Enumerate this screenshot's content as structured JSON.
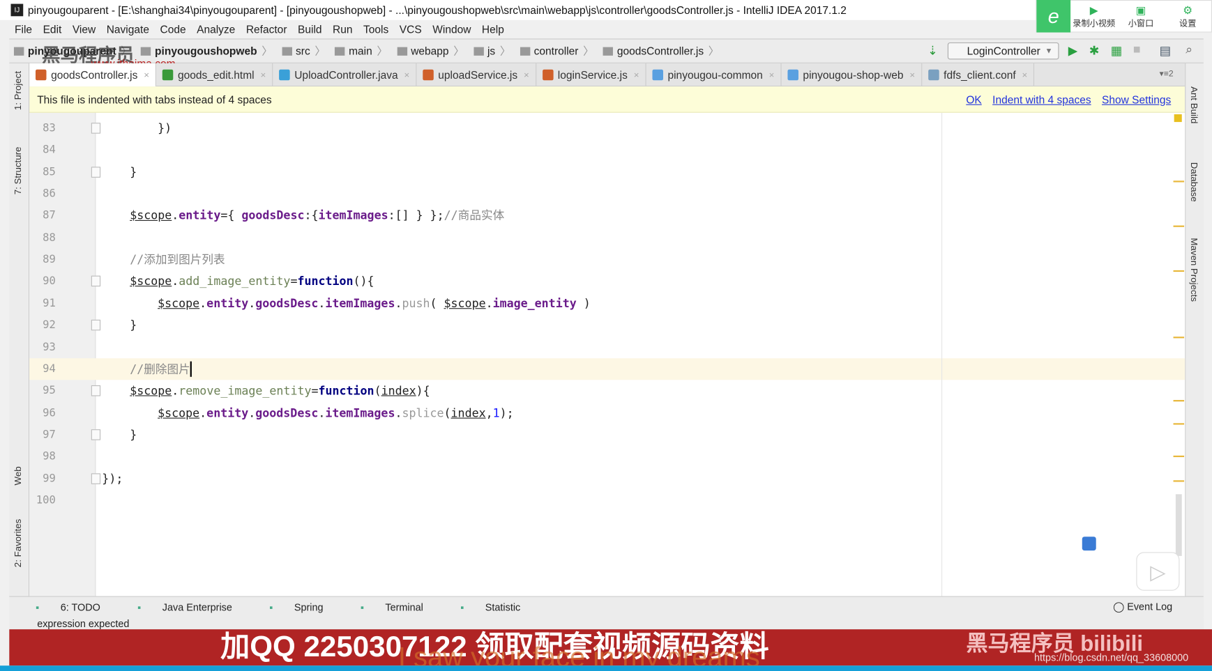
{
  "window": {
    "title": "pinyougouparent - [E:\\shanghai34\\pinyougouparent] - [pinyougoushopweb] - ...\\pinyougoushopweb\\src\\main\\webapp\\js\\controller\\goodsController.js - IntelliJ IDEA 2017.1.2"
  },
  "recorder": {
    "logo": "e",
    "buttons": [
      {
        "icon": "video-icon",
        "label": "录制小视频"
      },
      {
        "icon": "tv-icon",
        "label": "小窗口"
      },
      {
        "icon": "gear-icon",
        "label": "设置"
      }
    ]
  },
  "menu": [
    "File",
    "Edit",
    "View",
    "Navigate",
    "Code",
    "Analyze",
    "Refactor",
    "Build",
    "Run",
    "Tools",
    "VCS",
    "Window",
    "Help"
  ],
  "breadcrumb": [
    "pinyougouparent",
    "pinyougoushopweb",
    "src",
    "main",
    "webapp",
    "js",
    "controller",
    "goodsController.js"
  ],
  "watermark": {
    "brand": "黑马程序员",
    "url": "www.itheima.com"
  },
  "toolbar": {
    "run_config": "LoginController"
  },
  "tabs": [
    {
      "label": "goodsController.js",
      "icon": "js",
      "active": true
    },
    {
      "label": "goods_edit.html",
      "icon": "html"
    },
    {
      "label": "UploadController.java",
      "icon": "java-class"
    },
    {
      "label": "uploadService.js",
      "icon": "js"
    },
    {
      "label": "loginService.js",
      "icon": "js"
    },
    {
      "label": "pinyougou-common",
      "icon": "maven"
    },
    {
      "label": "pinyougou-shop-web",
      "icon": "maven"
    },
    {
      "label": "fdfs_client.conf",
      "icon": "config"
    }
  ],
  "tabs_overflow": "2",
  "notice": {
    "text": "This file is indented with tabs instead of 4 spaces",
    "ok": "OK",
    "indent": "Indent with 4 spaces",
    "settings": "Show Settings"
  },
  "left_tools": [
    "1: Project",
    "7: Structure",
    "Web",
    "2: Favorites"
  ],
  "right_tools": [
    "Ant Build",
    "Database",
    "Maven Projects"
  ],
  "editor": {
    "current_line": 94,
    "lines": [
      {
        "n": 83,
        "indent": 2,
        "tokens": [
          [
            "plain",
            "})"
          ]
        ]
      },
      {
        "n": 84,
        "indent": 0,
        "tokens": []
      },
      {
        "n": 85,
        "indent": 1,
        "tokens": [
          [
            "plain",
            "}"
          ]
        ]
      },
      {
        "n": 86,
        "indent": 0,
        "tokens": []
      },
      {
        "n": 87,
        "indent": 1,
        "tokens": [
          [
            "var",
            "$scope"
          ],
          [
            "plain",
            "."
          ],
          [
            "prop",
            "entity"
          ],
          [
            "plain",
            "={ "
          ],
          [
            "prop",
            "goodsDesc"
          ],
          [
            "plain",
            ":{"
          ],
          [
            "prop",
            "itemImages"
          ],
          [
            "plain",
            ":[] } };"
          ],
          [
            "com",
            "//商品实体"
          ]
        ]
      },
      {
        "n": 88,
        "indent": 0,
        "tokens": []
      },
      {
        "n": 89,
        "indent": 1,
        "tokens": [
          [
            "com",
            "//添加到图片列表"
          ]
        ]
      },
      {
        "n": 90,
        "indent": 1,
        "tokens": [
          [
            "var",
            "$scope"
          ],
          [
            "plain",
            "."
          ],
          [
            "fn",
            "add_image_entity"
          ],
          [
            "plain",
            "="
          ],
          [
            "kw",
            "function"
          ],
          [
            "plain",
            "(){"
          ]
        ]
      },
      {
        "n": 91,
        "indent": 2,
        "tokens": [
          [
            "var",
            "$scope"
          ],
          [
            "plain",
            "."
          ],
          [
            "prop",
            "entity"
          ],
          [
            "plain",
            "."
          ],
          [
            "prop",
            "goodsDesc"
          ],
          [
            "plain",
            "."
          ],
          [
            "prop",
            "itemImages"
          ],
          [
            "plain",
            "."
          ],
          [
            "meth",
            "push"
          ],
          [
            "plain",
            "( "
          ],
          [
            "var",
            "$scope"
          ],
          [
            "plain",
            "."
          ],
          [
            "prop",
            "image_entity"
          ],
          [
            "plain",
            " )"
          ]
        ]
      },
      {
        "n": 92,
        "indent": 1,
        "tokens": [
          [
            "plain",
            "}"
          ]
        ]
      },
      {
        "n": 93,
        "indent": 0,
        "tokens": []
      },
      {
        "n": 94,
        "indent": 1,
        "tokens": [
          [
            "com",
            "//删除图片"
          ]
        ]
      },
      {
        "n": 95,
        "indent": 1,
        "tokens": [
          [
            "var",
            "$scope"
          ],
          [
            "plain",
            "."
          ],
          [
            "fn",
            "remove_image_entity"
          ],
          [
            "plain",
            "="
          ],
          [
            "kw",
            "function"
          ],
          [
            "plain",
            "("
          ],
          [
            "param",
            "index"
          ],
          [
            "plain",
            "){"
          ]
        ]
      },
      {
        "n": 96,
        "indent": 2,
        "tokens": [
          [
            "var",
            "$scope"
          ],
          [
            "plain",
            "."
          ],
          [
            "prop",
            "entity"
          ],
          [
            "plain",
            "."
          ],
          [
            "prop",
            "goodsDesc"
          ],
          [
            "plain",
            "."
          ],
          [
            "prop",
            "itemImages"
          ],
          [
            "plain",
            "."
          ],
          [
            "meth",
            "splice"
          ],
          [
            "plain",
            "("
          ],
          [
            "param",
            "index"
          ],
          [
            "plain",
            ","
          ],
          [
            "num",
            "1"
          ],
          [
            "plain",
            ");"
          ]
        ]
      },
      {
        "n": 97,
        "indent": 1,
        "tokens": [
          [
            "plain",
            "}"
          ]
        ]
      },
      {
        "n": 98,
        "indent": 0,
        "tokens": []
      },
      {
        "n": 99,
        "indent": 0,
        "tokens": [
          [
            "plain",
            "});"
          ]
        ]
      },
      {
        "n": 100,
        "indent": 0,
        "tokens": []
      }
    ]
  },
  "bottom_tools": [
    "6: TODO",
    "Java Enterprise",
    "Spring",
    "Terminal",
    "Statistic"
  ],
  "event_log": "Event Log",
  "status": {
    "message": "expression expected"
  },
  "banner": {
    "text": "加QQ 2250307122 领取配套视频源码资料",
    "lyric": "I saw your face in my dreams",
    "bili": "黑马程序员 bilibili",
    "url": "https://blog.csdn.net/qq_33608000"
  }
}
